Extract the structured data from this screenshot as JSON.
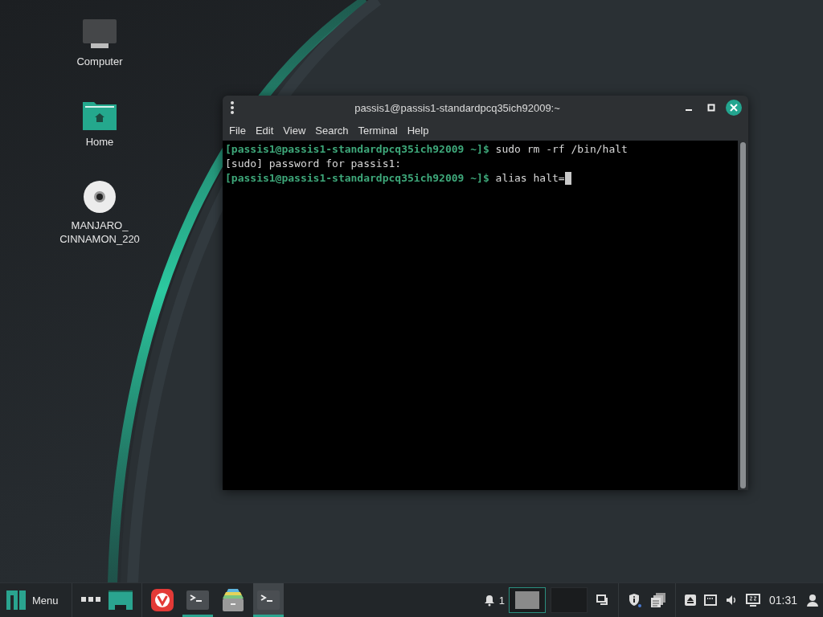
{
  "desktop": {
    "icons": [
      {
        "kind": "computer",
        "lines": [
          "Computer"
        ]
      },
      {
        "kind": "folder",
        "lines": [
          "Home"
        ]
      },
      {
        "kind": "disc",
        "lines": [
          "MANJARO_",
          "CINNAMON_220"
        ]
      }
    ]
  },
  "terminal": {
    "title": "passis1@passis1-standardpcq35ich92009:~",
    "menu": [
      "File",
      "Edit",
      "View",
      "Search",
      "Terminal",
      "Help"
    ],
    "lines": [
      {
        "kind": "prompt",
        "prompt": "[passis1@passis1-standardpcq35ich92009 ~]$",
        "command": "sudo rm -rf /bin/halt",
        "cursor": false
      },
      {
        "kind": "output",
        "text": "[sudo] password for passis1:"
      },
      {
        "kind": "prompt",
        "prompt": "[passis1@passis1-standardpcq35ich92009 ~]$",
        "command": "alias halt=",
        "cursor": true
      }
    ]
  },
  "taskbar": {
    "menu_label": "Menu",
    "launchers": [
      {
        "kind": "browser",
        "running": false,
        "selected": false
      },
      {
        "kind": "terminal",
        "running": true,
        "selected": false
      },
      {
        "kind": "files",
        "running": false,
        "selected": false
      },
      {
        "kind": "terminal",
        "running": true,
        "selected": true
      }
    ],
    "notifications": "1",
    "workspaces": [
      {
        "selected": true
      },
      {
        "selected": false
      }
    ],
    "clock": "01:31"
  }
}
